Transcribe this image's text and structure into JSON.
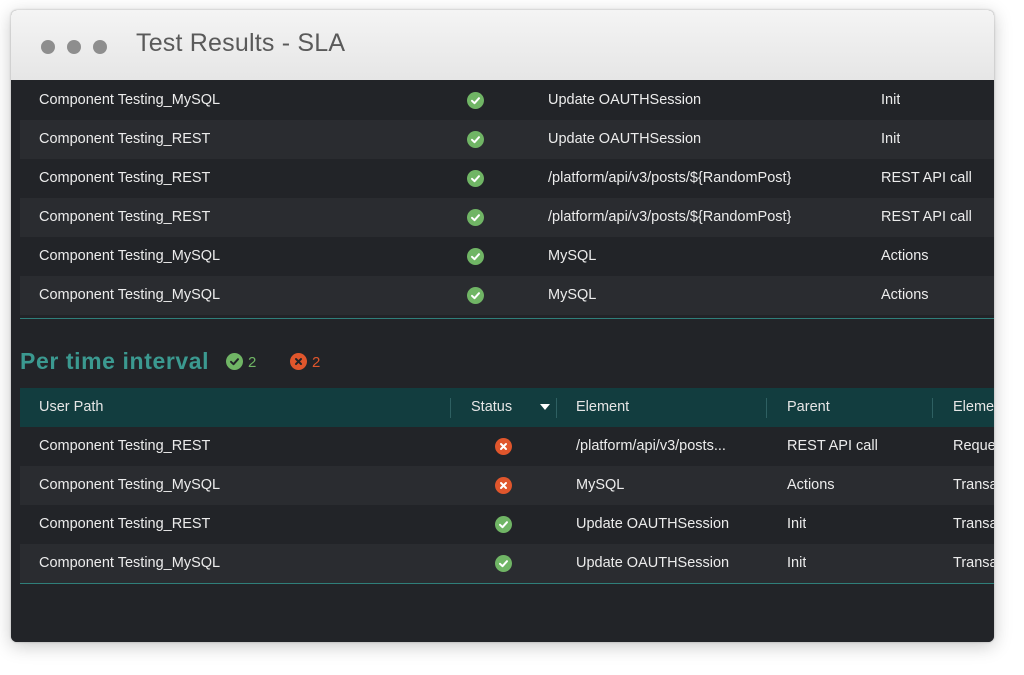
{
  "window": {
    "title": "Test Results - SLA"
  },
  "top_table": {
    "rows": [
      {
        "user_path": "Component Testing_MySQL",
        "status": "pass",
        "element": "Update OAUTHSession",
        "parent": "Init"
      },
      {
        "user_path": "Component Testing_REST",
        "status": "pass",
        "element": "Update OAUTHSession",
        "parent": "Init"
      },
      {
        "user_path": "Component Testing_REST",
        "status": "pass",
        "element": "/platform/api/v3/posts/${RandomPost}",
        "parent": "REST API call"
      },
      {
        "user_path": "Component Testing_REST",
        "status": "pass",
        "element": "/platform/api/v3/posts/${RandomPost}",
        "parent": "REST API call"
      },
      {
        "user_path": "Component Testing_MySQL",
        "status": "pass",
        "element": "MySQL",
        "parent": "Actions"
      },
      {
        "user_path": "Component Testing_MySQL",
        "status": "pass",
        "element": "MySQL",
        "parent": "Actions"
      }
    ]
  },
  "per_time_interval": {
    "title": "Per time interval",
    "pass_count": "2",
    "fail_count": "2",
    "columns": {
      "user_path": "User Path",
      "status": "Status",
      "element": "Element",
      "parent": "Parent",
      "element_type": "Eleme"
    },
    "rows": [
      {
        "user_path": "Component Testing_REST",
        "status": "fail",
        "element": "/platform/api/v3/posts...",
        "parent": "REST API call",
        "element_type": "Reque"
      },
      {
        "user_path": "Component Testing_MySQL",
        "status": "fail",
        "element": "MySQL",
        "parent": "Actions",
        "element_type": "Transa"
      },
      {
        "user_path": "Component Testing_REST",
        "status": "pass",
        "element": "Update OAUTHSession",
        "parent": "Init",
        "element_type": "Transa"
      },
      {
        "user_path": "Component Testing_MySQL",
        "status": "pass",
        "element": "Update OAUTHSession",
        "parent": "Init",
        "element_type": "Transa"
      }
    ]
  },
  "colors": {
    "pass": "#70b565",
    "fail": "#e0562c",
    "accent": "#3b9990",
    "header_bg": "#123d3f",
    "background": "#222428"
  },
  "icons": {
    "pass": "check-circle-icon",
    "fail": "x-circle-icon",
    "sort": "caret-down-icon"
  }
}
